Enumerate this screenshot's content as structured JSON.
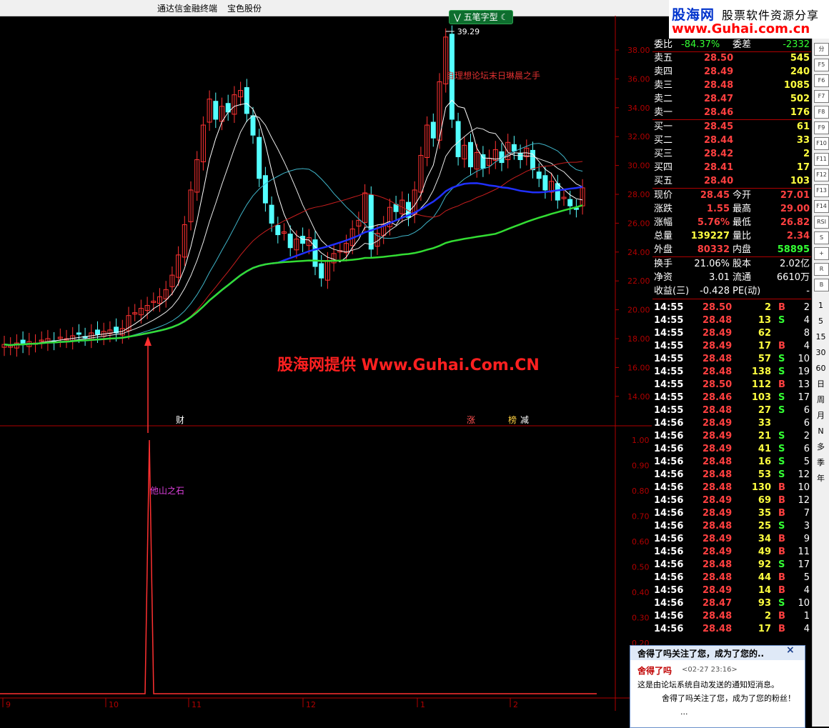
{
  "app": {
    "title_left": "通达信金融终端",
    "title_right": "宝色股份"
  },
  "logo": {
    "line1": "股海网",
    "line1b": "股票软件资源分享",
    "line2": "www.Guhai.com.cn"
  },
  "chart_tag": "五笔字型",
  "chart_data": {
    "type": "candlestick",
    "y_ticks": [
      "38.00",
      "36.00",
      "34.00",
      "32.00",
      "30.00",
      "28.00",
      "26.00",
      "24.00",
      "22.00",
      "20.00",
      "18.00",
      "16.00",
      "14.00"
    ],
    "x_ticks": [
      "9",
      "10",
      "11",
      "12",
      "1",
      "2"
    ],
    "high_label": "39.29",
    "annotation": "自理想论坛末日琳晨之手",
    "watermark": "股海网提供 Www.Guhai.Com.CN",
    "event_marks": [
      "财",
      "涨",
      "榜",
      "减"
    ],
    "indicator": {
      "y_ticks": [
        "1.00",
        "0.90",
        "0.80",
        "0.70",
        "0.60",
        "0.50",
        "0.40",
        "0.30",
        "0.20"
      ],
      "label": "他山之石",
      "spike_x_category": "10",
      "spike_value": 1.0
    },
    "close_approx": [
      17.6,
      17.5,
      17.7,
      17.6,
      17.8,
      17.7,
      17.9,
      18.0,
      17.8,
      18.1,
      18.0,
      18.2,
      18.3,
      18.1,
      18.4,
      18.3,
      18.5,
      18.6,
      18.4,
      18.7,
      19.6,
      19.8,
      20.1,
      20.3,
      20.6,
      20.9,
      21.4,
      22.4,
      23.8,
      25.9,
      28.3,
      30.4,
      32.8,
      34.6,
      33.2,
      34.1,
      33.7,
      34.9,
      35.2,
      33.6,
      32.1,
      29.1,
      27.4,
      26.0,
      25.2,
      25.4,
      24.3,
      24.9,
      24.6,
      25.0,
      23.0,
      22.2,
      23.4,
      23.9,
      24.1,
      24.6,
      25.6,
      26.2,
      28.1,
      24.2,
      25.3,
      25.9,
      27.1,
      26.8,
      27.6,
      26.4,
      28.3,
      30.7,
      32.8,
      31.9,
      35.8,
      38.9,
      33.2,
      30.6,
      31.4,
      29.9,
      30.9,
      29.8,
      30.5,
      31.1,
      30.2,
      31.6,
      31.0,
      30.4,
      31.2,
      29.7,
      29.1,
      28.3,
      28.9,
      27.6,
      27.8,
      27.2,
      27.0,
      28.45
    ]
  },
  "quote": {
    "wb": {
      "label": "委比",
      "value": "-84.37%",
      "label2": "委差",
      "value2": "-2332"
    },
    "sell": [
      {
        "label": "卖五",
        "price": "28.50",
        "vol": "545"
      },
      {
        "label": "卖四",
        "price": "28.49",
        "vol": "240"
      },
      {
        "label": "卖三",
        "price": "28.48",
        "vol": "1085"
      },
      {
        "label": "卖二",
        "price": "28.47",
        "vol": "502"
      },
      {
        "label": "卖一",
        "price": "28.46",
        "vol": "176"
      }
    ],
    "buy": [
      {
        "label": "买一",
        "price": "28.45",
        "vol": "61"
      },
      {
        "label": "买二",
        "price": "28.44",
        "vol": "33"
      },
      {
        "label": "买三",
        "price": "28.42",
        "vol": "2"
      },
      {
        "label": "买四",
        "price": "28.41",
        "vol": "17"
      },
      {
        "label": "买五",
        "price": "28.40",
        "vol": "103"
      }
    ],
    "stats": [
      {
        "l1": "现价",
        "v1": "28.45",
        "c1": "#ff4040",
        "l2": "今开",
        "v2": "27.01",
        "c2": "#ff4040"
      },
      {
        "l1": "涨跌",
        "v1": "1.55",
        "c1": "#ff4040",
        "l2": "最高",
        "v2": "29.00",
        "c2": "#ff4040"
      },
      {
        "l1": "涨幅",
        "v1": "5.76%",
        "c1": "#ff4040",
        "l2": "最低",
        "v2": "26.82",
        "c2": "#ff4040"
      },
      {
        "l1": "总量",
        "v1": "139227",
        "c1": "#ffff40",
        "l2": "量比",
        "v2": "2.34",
        "c2": "#ff4040"
      },
      {
        "l1": "外盘",
        "v1": "80332",
        "c1": "#ff4040",
        "l2": "内盘",
        "v2": "58895",
        "c2": "#33ff33"
      }
    ],
    "stats2": [
      {
        "l1": "换手",
        "v1": "21.06%",
        "l2": "股本",
        "v2": "2.02亿"
      },
      {
        "l1": "净资",
        "v1": "3.01",
        "l2": "流通",
        "v2": "6610万"
      },
      {
        "l1": "收益(三)",
        "v1": "-0.428",
        "l2": "PE(动)",
        "v2": "-"
      }
    ],
    "ticks": [
      {
        "t": "14:55",
        "p": "28.50",
        "v": "2",
        "s": "B",
        "n": "2"
      },
      {
        "t": "14:55",
        "p": "28.48",
        "v": "13",
        "s": "S",
        "n": "4"
      },
      {
        "t": "14:55",
        "p": "28.49",
        "v": "62",
        "s": "",
        "n": "8"
      },
      {
        "t": "14:55",
        "p": "28.49",
        "v": "17",
        "s": "B",
        "n": "4"
      },
      {
        "t": "14:55",
        "p": "28.48",
        "v": "57",
        "s": "S",
        "n": "10"
      },
      {
        "t": "14:55",
        "p": "28.48",
        "v": "138",
        "s": "S",
        "n": "19"
      },
      {
        "t": "14:55",
        "p": "28.50",
        "v": "112",
        "s": "B",
        "n": "13"
      },
      {
        "t": "14:55",
        "p": "28.46",
        "v": "103",
        "s": "S",
        "n": "17"
      },
      {
        "t": "14:55",
        "p": "28.48",
        "v": "27",
        "s": "S",
        "n": "6"
      },
      {
        "t": "14:56",
        "p": "28.49",
        "v": "33",
        "s": "",
        "n": "6"
      },
      {
        "t": "14:56",
        "p": "28.49",
        "v": "21",
        "s": "S",
        "n": "2"
      },
      {
        "t": "14:56",
        "p": "28.49",
        "v": "41",
        "s": "S",
        "n": "6"
      },
      {
        "t": "14:56",
        "p": "28.48",
        "v": "16",
        "s": "S",
        "n": "5"
      },
      {
        "t": "14:56",
        "p": "28.48",
        "v": "53",
        "s": "S",
        "n": "12"
      },
      {
        "t": "14:56",
        "p": "28.48",
        "v": "130",
        "s": "B",
        "n": "10"
      },
      {
        "t": "14:56",
        "p": "28.49",
        "v": "69",
        "s": "B",
        "n": "12"
      },
      {
        "t": "14:56",
        "p": "28.49",
        "v": "35",
        "s": "B",
        "n": "7"
      },
      {
        "t": "14:56",
        "p": "28.48",
        "v": "25",
        "s": "S",
        "n": "3"
      },
      {
        "t": "14:56",
        "p": "28.49",
        "v": "34",
        "s": "B",
        "n": "9"
      },
      {
        "t": "14:56",
        "p": "28.49",
        "v": "49",
        "s": "B",
        "n": "11"
      },
      {
        "t": "14:56",
        "p": "28.48",
        "v": "92",
        "s": "S",
        "n": "17"
      },
      {
        "t": "14:56",
        "p": "28.48",
        "v": "44",
        "s": "B",
        "n": "5"
      },
      {
        "t": "14:56",
        "p": "28.49",
        "v": "14",
        "s": "B",
        "n": "4"
      },
      {
        "t": "14:56",
        "p": "28.47",
        "v": "93",
        "s": "S",
        "n": "10"
      },
      {
        "t": "14:56",
        "p": "28.48",
        "v": "2",
        "s": "B",
        "n": "1"
      },
      {
        "t": "14:56",
        "p": "28.48",
        "v": "17",
        "s": "B",
        "n": "4"
      }
    ]
  },
  "toolbar": {
    "icons": [
      "分",
      "F5",
      "F6",
      "F7",
      "F8",
      "F9",
      "F10",
      "F11",
      "F12",
      "F13",
      "F14",
      "RSI",
      "S",
      "+",
      "R",
      "B"
    ],
    "periods": [
      "1",
      "5",
      "15",
      "30",
      "60",
      "日",
      "周",
      "月",
      "N",
      "多",
      "季",
      "年"
    ]
  },
  "popup": {
    "title": "舍得了吗关注了您，成为了您的..",
    "sender": "舍得了吗",
    "time": "<02-27 23:16>",
    "body1": "这是由论坛系统自动发送的通知短消息。",
    "body2": "舍得了吗关注了您，成为了您的粉丝！",
    "body3": "..."
  },
  "colors": {
    "up": "#ff3232",
    "down": "#54ffff",
    "ma_blue": "#2030ff",
    "ma_green": "#33dd33",
    "ma_red": "#c81e1e"
  }
}
